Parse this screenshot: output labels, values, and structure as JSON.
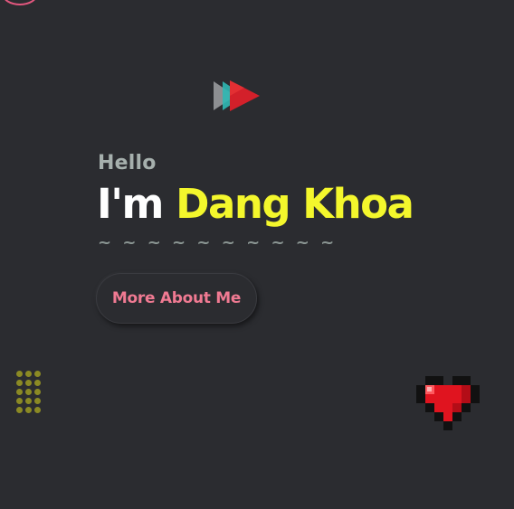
{
  "hero": {
    "greeting": "Hello",
    "intro": "I'm",
    "name": "Dang Khoa",
    "divider": "~ ~ ~ ~ ~ ~ ~ ~ ~ ~",
    "cta_label": "More About Me"
  },
  "decor": {
    "play_icon": "fast-forward-icon",
    "heart_icon": "pixel-heart-icon",
    "dot_grid": "dot-grid-pattern",
    "corner_circle": "circle-outline"
  },
  "colors": {
    "background": "#2b2c30",
    "name_accent": "#f4f72c",
    "cta_text": "#f07a92",
    "greeting": "#a6b0ad",
    "dots": "#8b8a24",
    "heart": "#e0141f"
  }
}
